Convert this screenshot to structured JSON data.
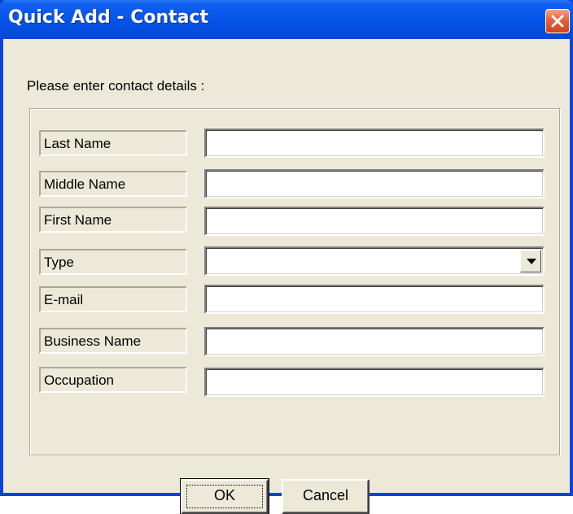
{
  "window": {
    "title": "Quick Add - Contact",
    "close_icon": "close-icon"
  },
  "form": {
    "prompt": "Please enter contact details :",
    "fields": [
      {
        "label": "Last Name",
        "value": ""
      },
      {
        "label": "Middle Name",
        "value": ""
      },
      {
        "label": "First Name",
        "value": ""
      },
      {
        "label": "Type",
        "value": "",
        "control": "dropdown"
      },
      {
        "label": "E-mail",
        "value": ""
      },
      {
        "label": "Business Name",
        "value": ""
      },
      {
        "label": "Occupation",
        "value": ""
      }
    ]
  },
  "buttons": {
    "ok": "OK",
    "cancel": "Cancel"
  },
  "colors": {
    "titlebar": "#0552e8",
    "client_bg": "#ece9d8",
    "close_button": "#e6603a"
  }
}
